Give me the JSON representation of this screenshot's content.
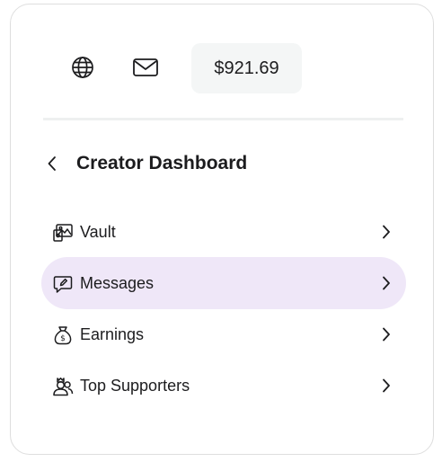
{
  "balance": "$921.69",
  "header": {
    "title": "Creator Dashboard"
  },
  "menu": {
    "items": [
      {
        "label": "Vault",
        "icon": "vault-icon",
        "active": false
      },
      {
        "label": "Messages",
        "icon": "messages-icon",
        "active": true
      },
      {
        "label": "Earnings",
        "icon": "money-bag-icon",
        "active": false
      },
      {
        "label": "Top Supporters",
        "icon": "supporters-icon",
        "active": false
      }
    ]
  },
  "colors": {
    "active_item_bg": "#efe7f8",
    "balance_bg": "#f4f6f6",
    "text": "#1c1c1e",
    "border": "#dedede"
  }
}
